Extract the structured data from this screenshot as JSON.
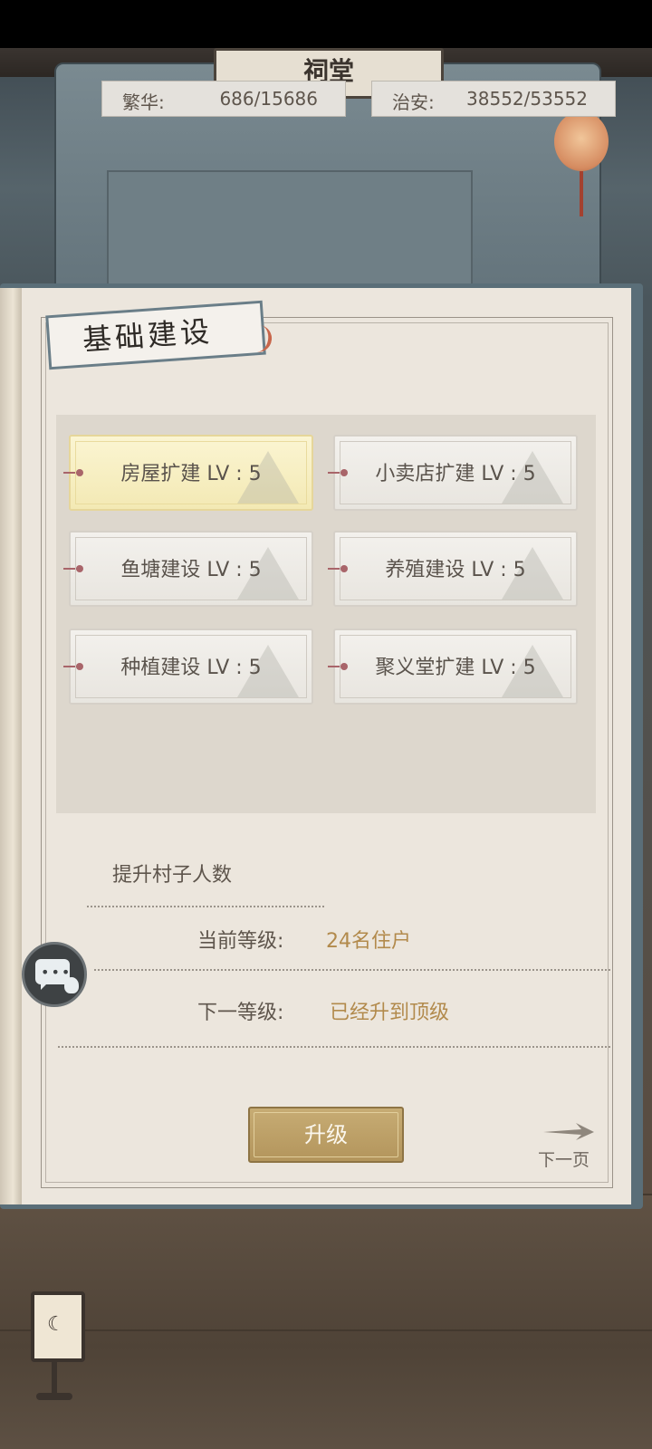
{
  "header": {
    "shrine_sign": "祠堂",
    "stats": [
      {
        "label": "繁华:",
        "value": "686/15686"
      },
      {
        "label": "治安:",
        "value": "38552/53552"
      }
    ]
  },
  "book": {
    "title": "基础建设",
    "buildings": [
      {
        "label": "房屋扩建 LV : 5",
        "selected": true
      },
      {
        "label": "小卖店扩建 LV : 5",
        "selected": false
      },
      {
        "label": "鱼塘建设 LV : 5",
        "selected": false
      },
      {
        "label": "养殖建设 LV : 5",
        "selected": false
      },
      {
        "label": "种植建设 LV : 5",
        "selected": false
      },
      {
        "label": "聚义堂扩建 LV : 5",
        "selected": false
      }
    ],
    "detail": {
      "description": "提升村子人数",
      "current_label": "当前等级:",
      "current_value": "24名住户",
      "next_label": "下一等级:",
      "next_value": "已经升到顶级"
    },
    "upgrade_button": "升级",
    "next_page": "下一页"
  },
  "colors": {
    "selected_card": "#f3e9b4",
    "value_text": "#b28a4c",
    "button": "#b3955c"
  },
  "icons": [
    "chat-icon",
    "arrow-right-icon",
    "lantern-icon",
    "lamp-icon"
  ]
}
